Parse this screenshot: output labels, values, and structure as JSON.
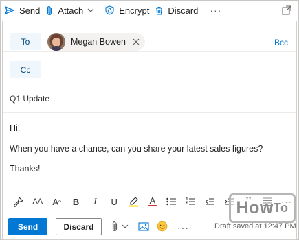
{
  "toolbar": {
    "send_label": "Send",
    "attach_label": "Attach",
    "encrypt_label": "Encrypt",
    "discard_label": "Discard",
    "more_label": "···"
  },
  "recipients": {
    "to_label": "To",
    "cc_label": "Cc",
    "bcc_label": "Bcc",
    "to_chips": [
      {
        "name": "Megan Bowen"
      }
    ]
  },
  "subject": {
    "value": "Q1 Update"
  },
  "message": {
    "lines": [
      "Hi!",
      "When you have a chance, can you share your latest sales figures?",
      "Thanks!"
    ]
  },
  "format_bar": {
    "items": [
      "format-painter",
      "font-size",
      "font-grow",
      "bold",
      "italic",
      "underline",
      "highlight",
      "font-color",
      "bullets",
      "numbering",
      "outdent",
      "indent",
      "quote",
      "align",
      "more"
    ],
    "labels": {
      "font_size": "AA",
      "font_grow": "A",
      "bold": "B",
      "italic": "I",
      "underline": "U",
      "font_color": "A",
      "quote": "”",
      "more": "···"
    }
  },
  "actions": {
    "send_label": "Send",
    "discard_label": "Discard",
    "more_label": "···",
    "status_text": "Draft saved at 12:47 PM"
  },
  "watermark": {
    "how": "How",
    "to": "To"
  },
  "colors": {
    "accent": "#0078d4",
    "field_button_bg": "#eff6fc"
  }
}
